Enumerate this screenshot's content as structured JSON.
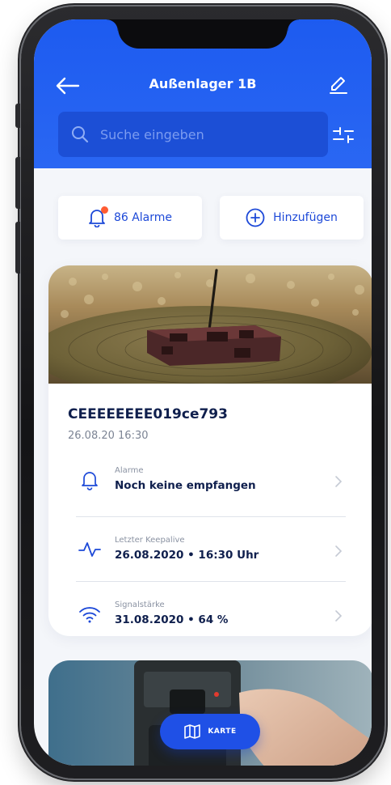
{
  "header": {
    "title": "Außenlager 1B",
    "back_icon": "arrow-left-icon",
    "edit_icon": "pencil-icon",
    "filter_icon": "sliders-icon"
  },
  "search": {
    "placeholder": "Suche eingeben",
    "value": ""
  },
  "actions": {
    "alarms_label": "86 Alarme",
    "add_label": "Hinzufügen"
  },
  "device": {
    "id": "CEEEEEEEE019ce793",
    "timestamp": "26.08.20 16:30",
    "rows": [
      {
        "label": "Alarme",
        "value": "Noch keine empfangen",
        "icon": "bell-icon"
      },
      {
        "label": "Letzter Keepalive",
        "value": "26.08.2020 • 16:30 Uhr",
        "icon": "pulse-icon"
      },
      {
        "label": "Signalstärke",
        "value": "31.08.2020 • 64 %",
        "icon": "wifi-icon"
      }
    ]
  },
  "map_button": {
    "label": "KARTE",
    "icon": "map-icon"
  },
  "colors": {
    "primary": "#1f50e6",
    "header": "#2a67f3",
    "text_dark": "#0f1f4d",
    "alert_dot": "#ff5c33"
  }
}
